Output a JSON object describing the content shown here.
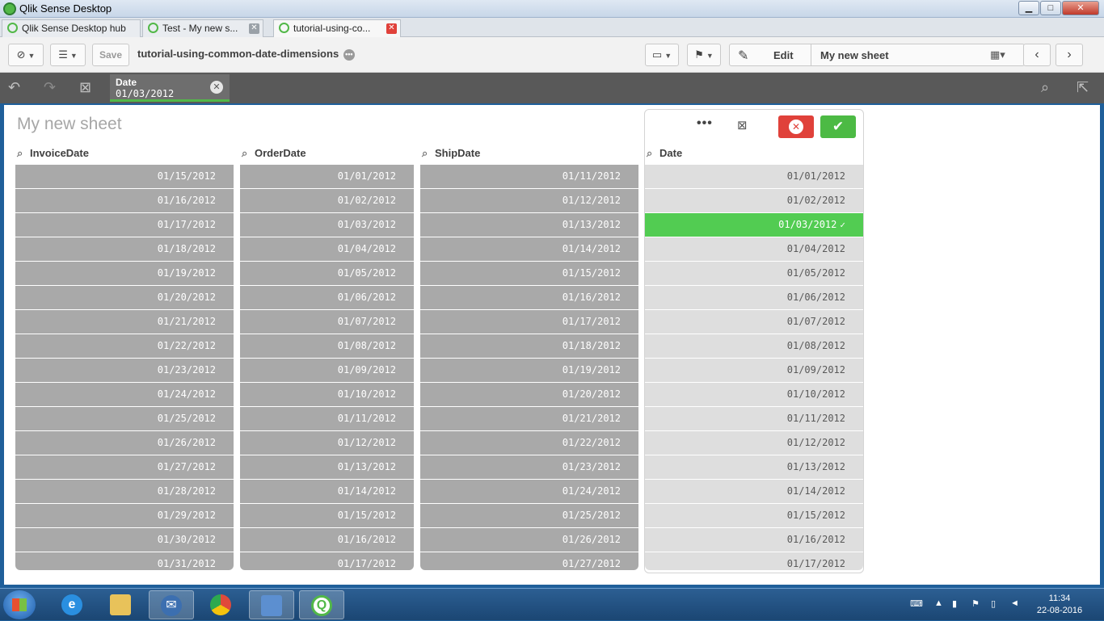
{
  "window": {
    "title": "Qlik Sense Desktop",
    "controls": {
      "minimize": "▁",
      "maximize": "□",
      "close": "✕"
    }
  },
  "tabs": [
    {
      "label": "Qlik Sense Desktop hub",
      "close": "",
      "active": false
    },
    {
      "label": "Test - My new s...",
      "close": "✕",
      "active": false
    },
    {
      "label": "tutorial-using-co...",
      "close": "✕",
      "active": true
    }
  ],
  "toolbar": {
    "save_label": "Save",
    "app_name": "tutorial-using-common-date-dimensions",
    "app_more": "•••",
    "edit_label": "Edit",
    "sheet_name": "My new sheet"
  },
  "selection_bar": {
    "field": "Date",
    "value": "01/03/2012"
  },
  "sheet": {
    "title": "My new sheet"
  },
  "listboxes": [
    {
      "header": "InvoiceDate",
      "values": [
        "01/15/2012",
        "01/16/2012",
        "01/17/2012",
        "01/18/2012",
        "01/19/2012",
        "01/20/2012",
        "01/21/2012",
        "01/22/2012",
        "01/23/2012",
        "01/24/2012",
        "01/25/2012",
        "01/26/2012",
        "01/27/2012",
        "01/28/2012",
        "01/29/2012",
        "01/30/2012",
        "01/31/2012"
      ]
    },
    {
      "header": "OrderDate",
      "values": [
        "01/01/2012",
        "01/02/2012",
        "01/03/2012",
        "01/04/2012",
        "01/05/2012",
        "01/06/2012",
        "01/07/2012",
        "01/08/2012",
        "01/09/2012",
        "01/10/2012",
        "01/11/2012",
        "01/12/2012",
        "01/13/2012",
        "01/14/2012",
        "01/15/2012",
        "01/16/2012",
        "01/17/2012"
      ]
    },
    {
      "header": "ShipDate",
      "values": [
        "01/11/2012",
        "01/12/2012",
        "01/13/2012",
        "01/14/2012",
        "01/15/2012",
        "01/16/2012",
        "01/17/2012",
        "01/18/2012",
        "01/19/2012",
        "01/20/2012",
        "01/21/2012",
        "01/22/2012",
        "01/23/2012",
        "01/24/2012",
        "01/25/2012",
        "01/26/2012",
        "01/27/2012"
      ]
    },
    {
      "header": "Date",
      "selected": "01/03/2012",
      "values": [
        "01/01/2012",
        "01/02/2012",
        "01/03/2012",
        "01/04/2012",
        "01/05/2012",
        "01/06/2012",
        "01/07/2012",
        "01/08/2012",
        "01/09/2012",
        "01/10/2012",
        "01/11/2012",
        "01/12/2012",
        "01/13/2012",
        "01/14/2012",
        "01/15/2012",
        "01/16/2012",
        "01/17/2012"
      ]
    }
  ],
  "selection_panel": {
    "more_label": "•••"
  },
  "taskbar": {
    "time": "11:34",
    "date": "22-08-2016"
  },
  "colors": {
    "selected_green": "#52cc52",
    "alternative_gray": "#a9a9a9",
    "possible_light": "#dedede",
    "cancel_red": "#e0413a",
    "confirm_green": "#4cba44"
  }
}
